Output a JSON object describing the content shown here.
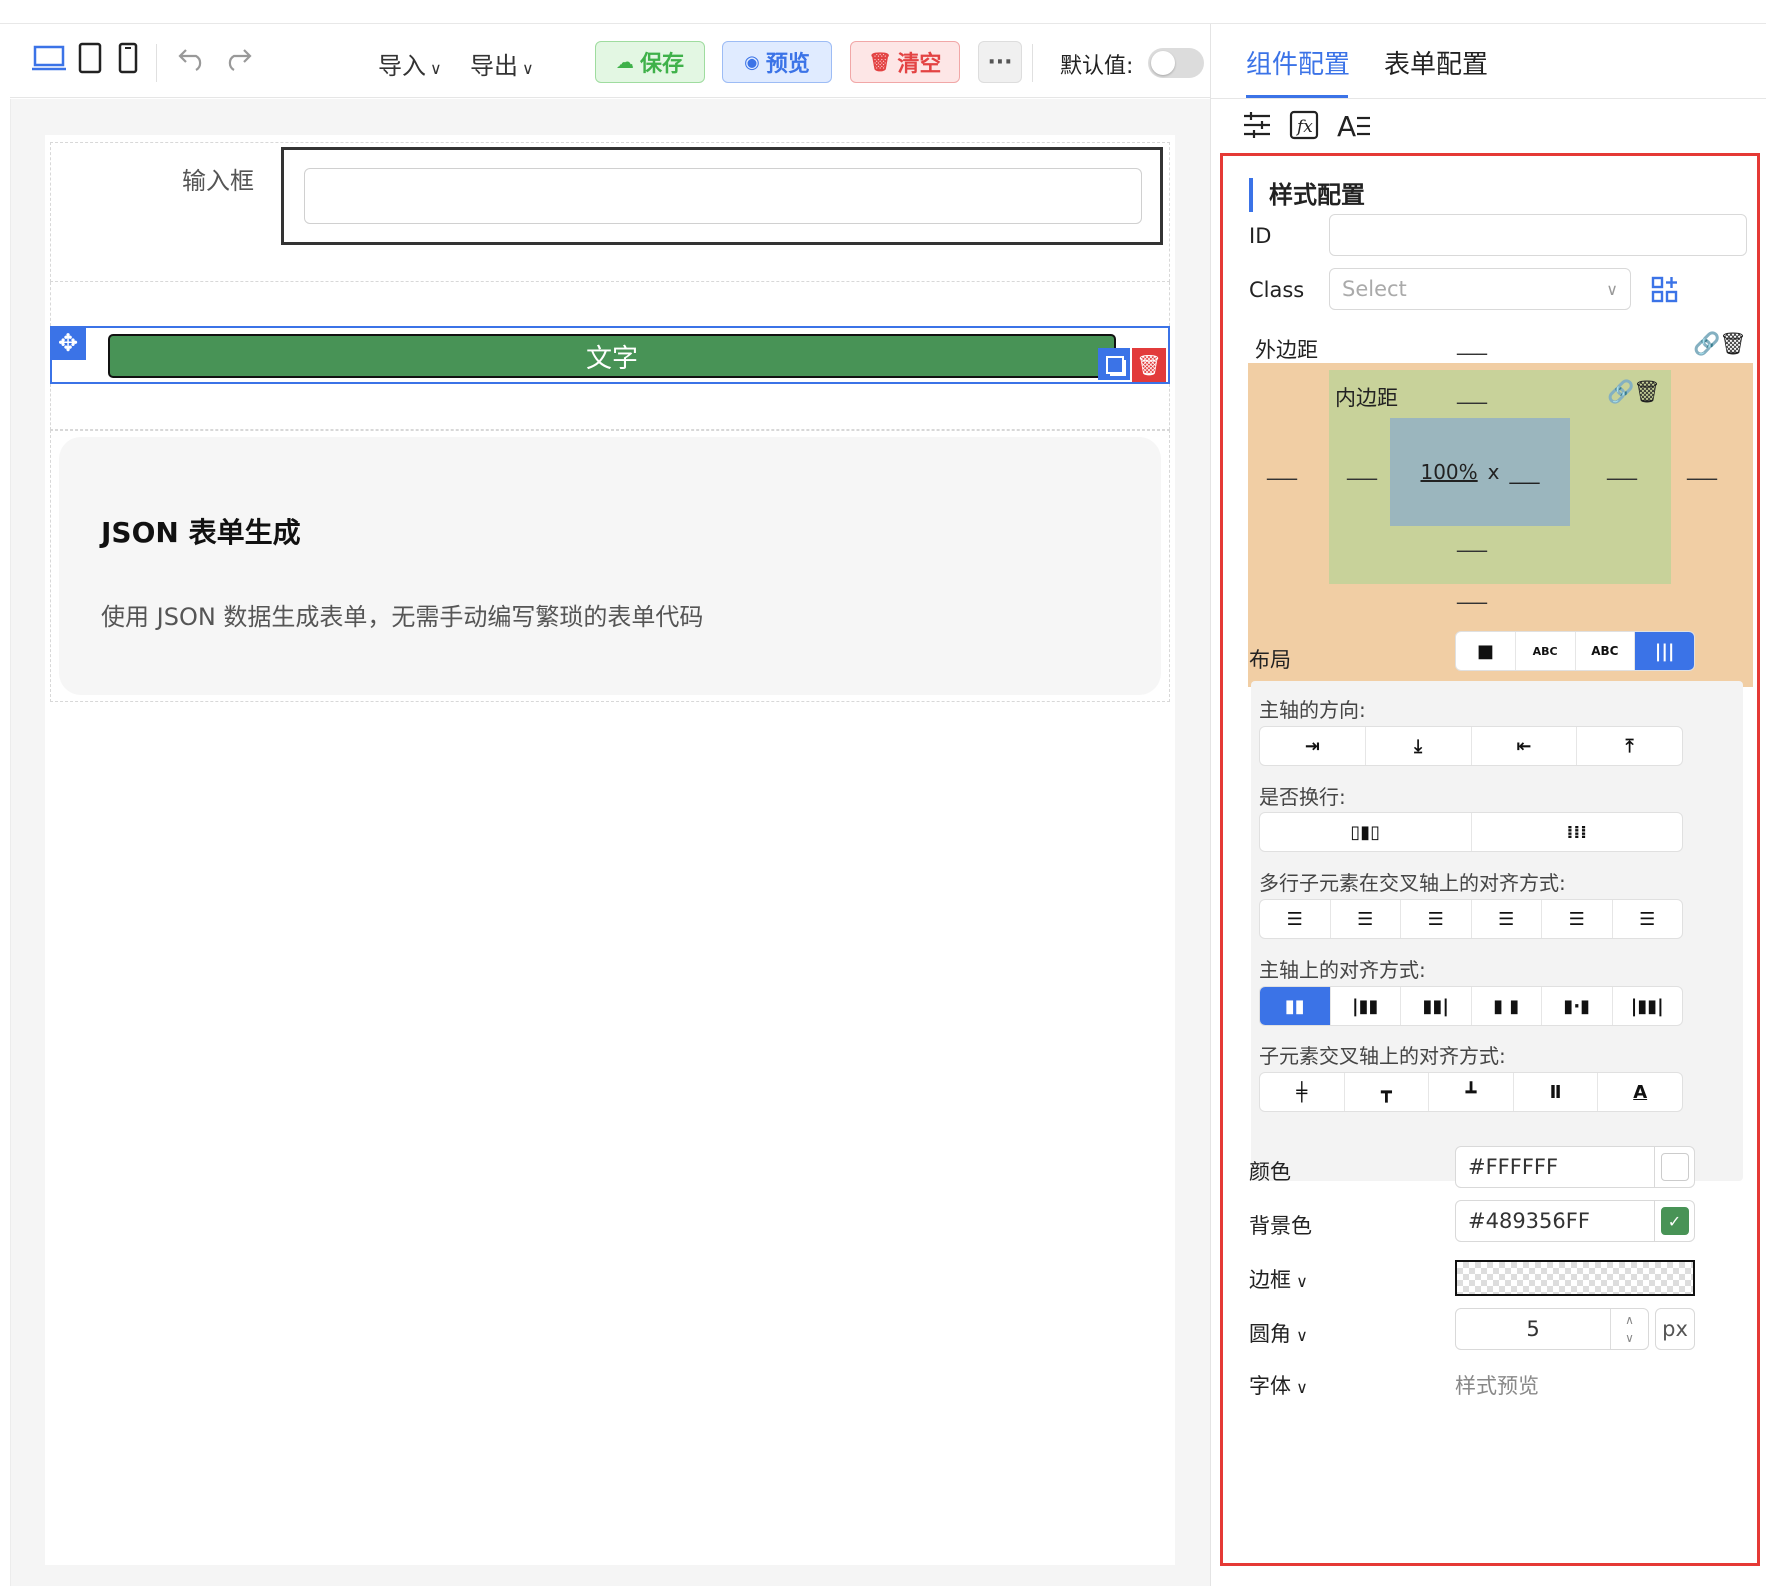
{
  "toolbar": {
    "import_label": "导入",
    "export_label": "导出",
    "save_label": "保存",
    "preview_label": "预览",
    "clear_label": "清空",
    "more_label": "···",
    "default_value_label": "默认值:"
  },
  "canvas": {
    "input_label": "输入框",
    "text_block_label": "文字",
    "card_title": "JSON 表单生成",
    "card_desc": "使用 JSON 数据生成表单，无需手动编写繁琐的表单代码"
  },
  "panel": {
    "tabs": [
      "组件配置",
      "表单配置"
    ],
    "section_title": "样式配置",
    "id_label": "ID",
    "class_label": "Class",
    "class_placeholder": "Select",
    "margin_label": "外边距",
    "padding_label": "内边距",
    "content_width": "100%",
    "content_x": "x",
    "content_height": "___",
    "dash": "___",
    "layout_label": "布局",
    "layout_options": [
      "■",
      "ABC",
      "ABC",
      "|||"
    ],
    "flex_direction_label": "主轴的方向:",
    "flex_wrap_label": "是否换行:",
    "align_content_label": "多行子元素在交叉轴上的对齐方式:",
    "justify_label": "主轴上的对齐方式:",
    "align_items_label": "子元素交叉轴上的对齐方式:",
    "color_label": "颜色",
    "color_value": "#FFFFFF",
    "bg_label": "背景色",
    "bg_value": "#489356FF",
    "border_label": "边框",
    "radius_label": "圆角",
    "radius_value": "5",
    "radius_unit": "px",
    "font_label": "字体",
    "style_preview_label": "样式预览"
  },
  "colors": {
    "accent": "#3b73e7",
    "text_block_bg": "#489356",
    "panel_outline": "#e53935"
  }
}
